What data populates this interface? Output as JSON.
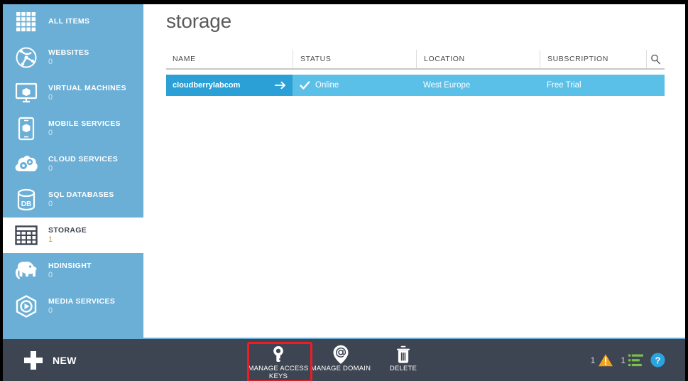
{
  "sidebar": {
    "items": [
      {
        "label": "ALL ITEMS",
        "count": null,
        "icon": "grid-icon",
        "selected": false
      },
      {
        "label": "WEBSITES",
        "count": "0",
        "icon": "globe-icon",
        "selected": false
      },
      {
        "label": "VIRTUAL MACHINES",
        "count": "0",
        "icon": "monitor-icon",
        "selected": false
      },
      {
        "label": "MOBILE SERVICES",
        "count": "0",
        "icon": "phone-icon",
        "selected": false
      },
      {
        "label": "CLOUD SERVICES",
        "count": "0",
        "icon": "cloud-gears-icon",
        "selected": false
      },
      {
        "label": "SQL DATABASES",
        "count": "0",
        "icon": "database-db-icon",
        "selected": false
      },
      {
        "label": "STORAGE",
        "count": "1",
        "icon": "storage-table-icon",
        "selected": true
      },
      {
        "label": "HDINSIGHT",
        "count": "0",
        "icon": "elephant-icon",
        "selected": false
      },
      {
        "label": "MEDIA SERVICES",
        "count": "0",
        "icon": "media-play-icon",
        "selected": false
      }
    ]
  },
  "main": {
    "title": "storage",
    "table": {
      "columns": [
        "NAME",
        "STATUS",
        "LOCATION",
        "SUBSCRIPTION"
      ],
      "search_icon": "search-icon",
      "rows": [
        {
          "name": "cloudberrylabcom",
          "status": "Online",
          "location": "West Europe",
          "subscription": "Free Trial",
          "selected": true,
          "arrow_icon": "arrow-right-icon",
          "status_icon": "check-icon"
        }
      ]
    }
  },
  "toolbar": {
    "new_label": "NEW",
    "new_icon": "plus-icon",
    "actions": [
      {
        "label": "MANAGE ACCESS KEYS",
        "icon": "key-icon",
        "highlighted": true
      },
      {
        "label": "MANAGE DOMAIN",
        "icon": "at-pin-icon",
        "highlighted": false
      },
      {
        "label": "DELETE",
        "icon": "trash-icon",
        "highlighted": false
      }
    ],
    "status": {
      "warning_count": "1",
      "warning_icon": "warning-triangle-icon",
      "jobs_count": "1",
      "jobs_icon": "list-bars-icon",
      "help_icon": "help-circle-icon"
    }
  },
  "colors": {
    "sidebar_blue": "#6bafd6",
    "row_blue": "#5bc0e8",
    "row_name_blue": "#2ba0d6",
    "toolbar_dark": "#3e4552",
    "highlight_red": "#ee1c25",
    "warning_orange": "#f0a31e",
    "jobs_green": "#7cc04b",
    "help_blue": "#29a4de",
    "count_gold": "#c29a52"
  }
}
